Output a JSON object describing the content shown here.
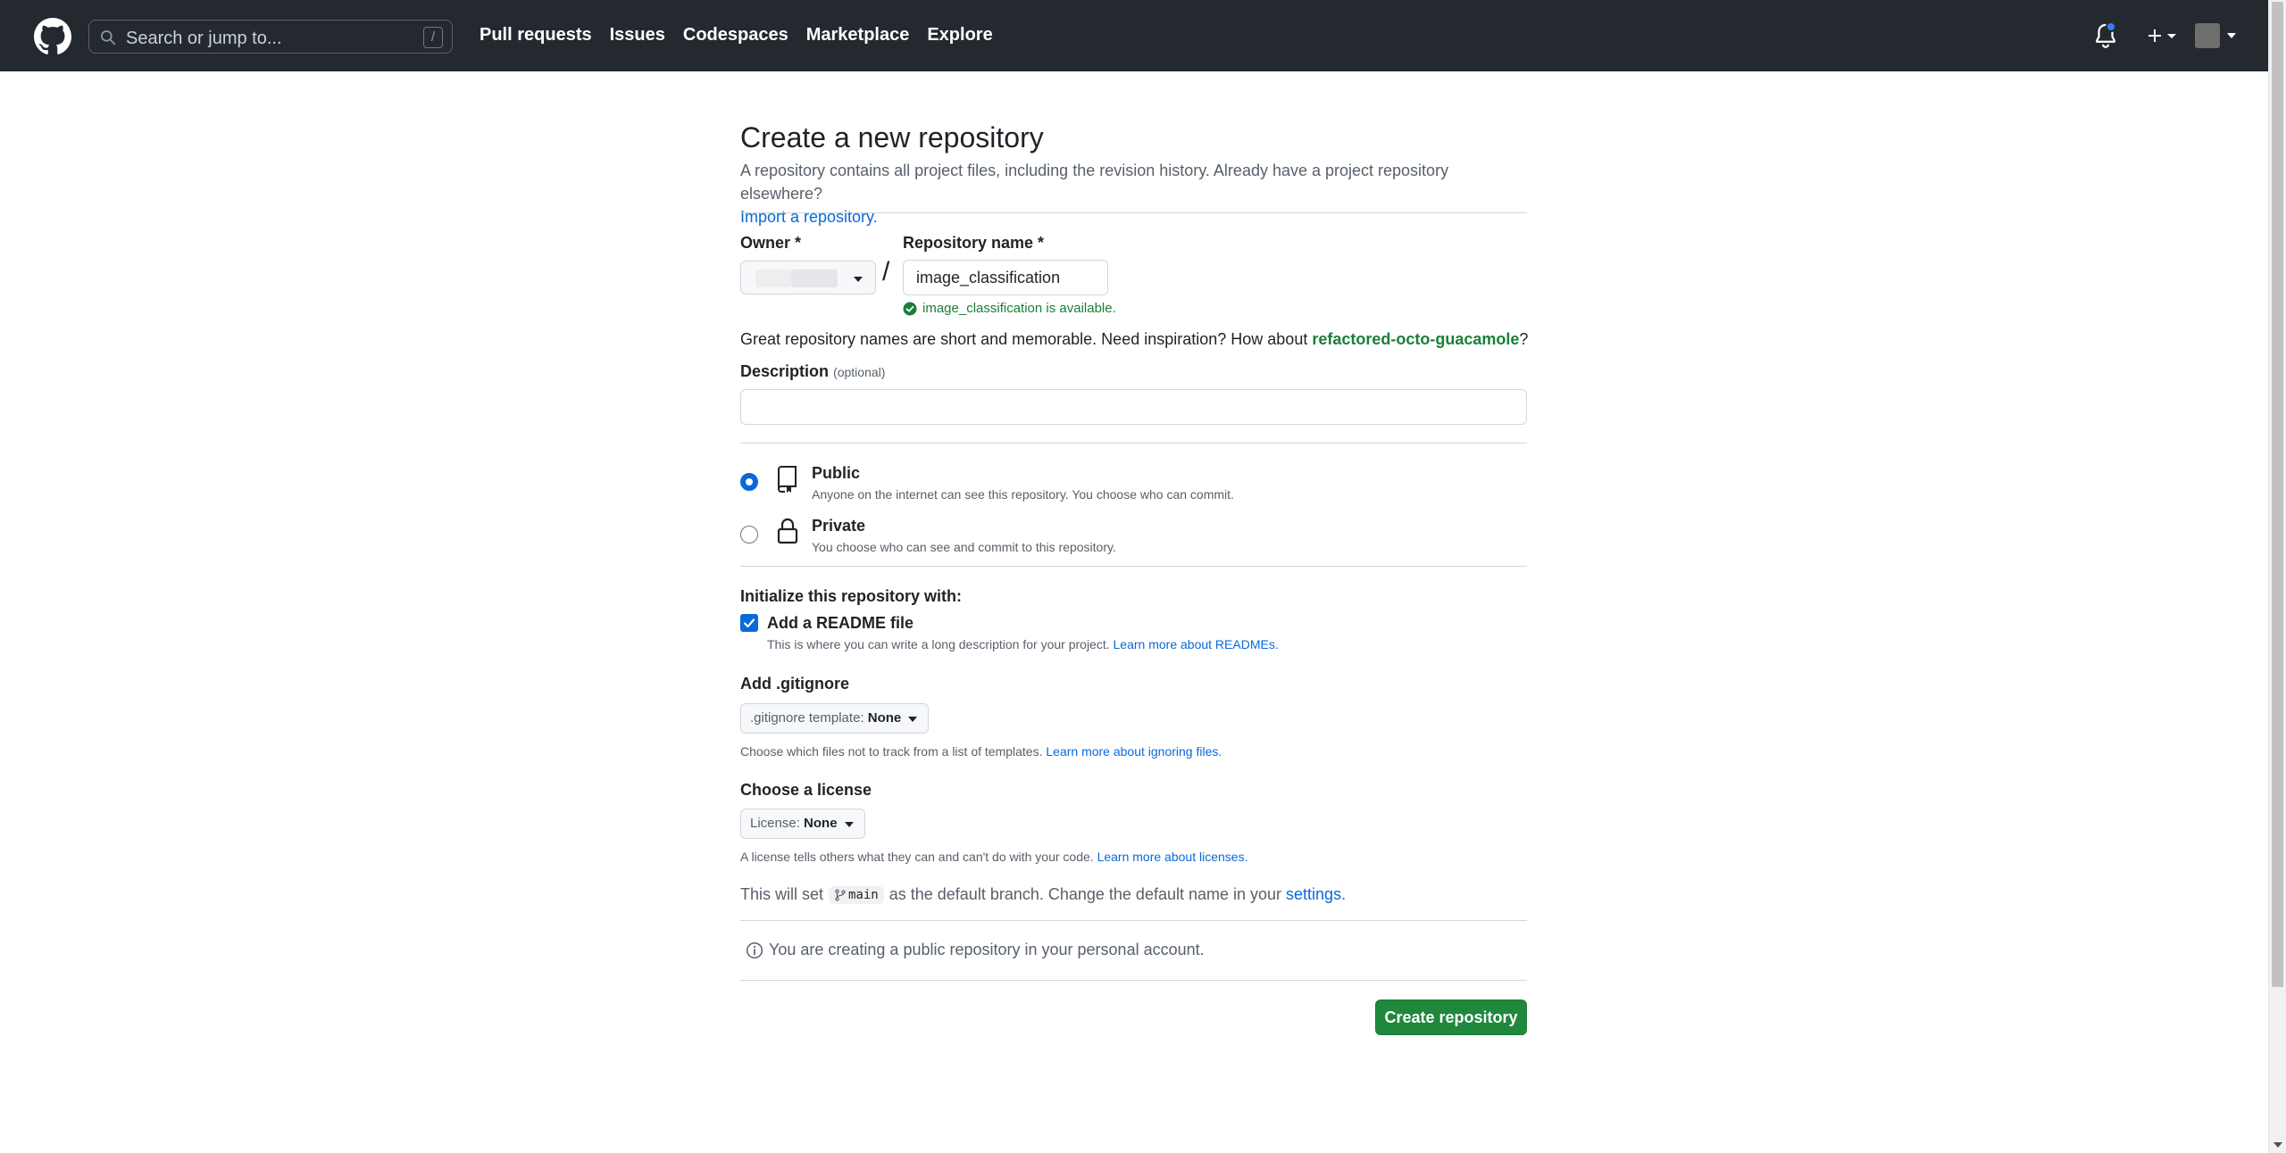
{
  "header": {
    "search_placeholder": "Search or jump to...",
    "search_shortcut": "/",
    "nav": [
      "Pull requests",
      "Issues",
      "Codespaces",
      "Marketplace",
      "Explore"
    ]
  },
  "page": {
    "title": "Create a new repository",
    "subtitle": "A repository contains all project files, including the revision history. Already have a project repository elsewhere?",
    "import_link": "Import a repository."
  },
  "owner": {
    "label": "Owner *"
  },
  "repo": {
    "label": "Repository name *",
    "value": "image_classification",
    "availability": "image_classification is available."
  },
  "inspiration": {
    "text": "Great repository names are short and memorable. Need inspiration? How about",
    "suggestion": "refactored-octo-guacamole",
    "suffix": "?"
  },
  "description": {
    "label": "Description",
    "optional": "(optional)",
    "value": ""
  },
  "visibility": {
    "public": {
      "title": "Public",
      "desc": "Anyone on the internet can see this repository. You choose who can commit.",
      "selected": true
    },
    "private": {
      "title": "Private",
      "desc": "You choose who can see and commit to this repository.",
      "selected": false
    }
  },
  "init": {
    "heading": "Initialize this repository with:",
    "readme_label": "Add a README file",
    "readme_checked": true,
    "readme_desc": "This is where you can write a long description for your project.",
    "readme_link": "Learn more about READMEs."
  },
  "gitignore": {
    "heading": "Add .gitignore",
    "button_prefix": ".gitignore template:",
    "button_value": "None",
    "desc": "Choose which files not to track from a list of templates.",
    "link": "Learn more about ignoring files."
  },
  "license": {
    "heading": "Choose a license",
    "button_prefix": "License:",
    "button_value": "None",
    "desc": "A license tells others what they can and can't do with your code.",
    "link": "Learn more about licenses."
  },
  "branch": {
    "prefix": "This will set",
    "name": "main",
    "suffix": "as the default branch. Change the default name in your",
    "link": "settings."
  },
  "info": {
    "text": "You are creating a public repository in your personal account."
  },
  "actions": {
    "create": "Create repository"
  },
  "colors": {
    "header_bg": "#24292f",
    "primary_button": "#1f883d",
    "link": "#0969da",
    "success": "#1a7f37"
  },
  "icons": [
    "github-logo-icon",
    "search-icon",
    "bell-icon",
    "plus-icon",
    "check-circle-icon",
    "repo-icon",
    "lock-icon",
    "git-branch-icon",
    "info-icon"
  ]
}
